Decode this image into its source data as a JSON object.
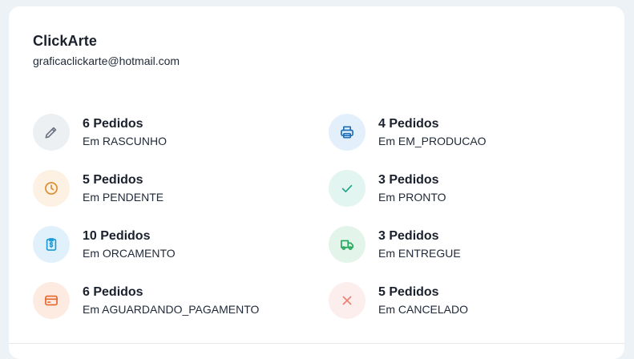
{
  "store": {
    "name": "ClickArte",
    "email": "graficaclickarte@hotmail.com"
  },
  "statuses": [
    {
      "count": "6 Pedidos",
      "label": "Em RASCUNHO",
      "icon": "pencil-icon",
      "bg": "#edf0f3",
      "color": "#6b7280"
    },
    {
      "count": "4 Pedidos",
      "label": "Em EM_PRODUCAO",
      "icon": "printer-icon",
      "bg": "#e3f0fc",
      "color": "#1e6fb8"
    },
    {
      "count": "5 Pedidos",
      "label": "Em PENDENTE",
      "icon": "clock-icon",
      "bg": "#fdf1e3",
      "color": "#e08b2c"
    },
    {
      "count": "3 Pedidos",
      "label": "Em PRONTO",
      "icon": "check-icon",
      "bg": "#e2f5f1",
      "color": "#1fa38a"
    },
    {
      "count": "10 Pedidos",
      "label": "Em ORCAMENTO",
      "icon": "clipboard-dollar-icon",
      "bg": "#e1f1fb",
      "color": "#1c9ad6"
    },
    {
      "count": "3 Pedidos",
      "label": "Em ENTREGUE",
      "icon": "truck-icon",
      "bg": "#e3f5ea",
      "color": "#22a659"
    },
    {
      "count": "6 Pedidos",
      "label": "Em AGUARDANDO_PAGAMENTO",
      "icon": "credit-card-icon",
      "bg": "#fdebe2",
      "color": "#e8662b"
    },
    {
      "count": "5 Pedidos",
      "label": "Em CANCELADO",
      "icon": "close-icon",
      "bg": "#fdeeee",
      "color": "#ee7b6c"
    }
  ]
}
